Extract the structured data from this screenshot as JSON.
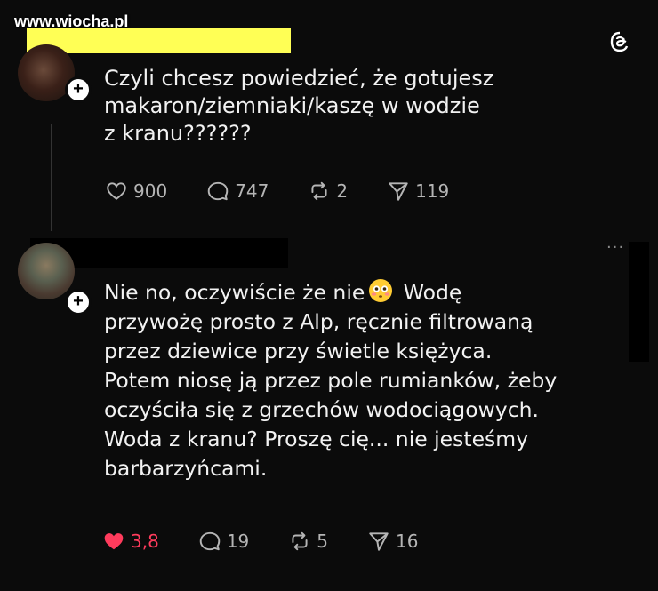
{
  "watermark": "www.wiocha.pl",
  "icons": {
    "threads": "threads-logo-icon",
    "like": "heart-icon",
    "reply": "comment-bubble-icon",
    "repost": "repost-icon",
    "share": "send-icon",
    "follow": "plus-icon",
    "more": "more-icon"
  },
  "colors": {
    "background": "#0b0b0b",
    "liked": "#ff3b5c",
    "redaction_yellow": "#ffff55"
  },
  "post1": {
    "follow_label": "+",
    "text": "Czyli chcesz powiedzieć, że gotujesz\nmakaron/ziemniaki/kaszę w wodzie\nz kranu??????",
    "stats": {
      "likes": "900",
      "replies": "747",
      "reposts": "2",
      "shares": "119"
    }
  },
  "post2": {
    "follow_label": "+",
    "text_before_emoji": "Nie no, oczywiście że nie",
    "text_after_emoji": " Wodę\nprzywożę prosto z Alp, ręcznie filtrowaną\nprzez dziewice przy świetle księżyca.\nPotem niosę ją przez pole rumianków, żeby\noczyściła się z grzechów wodociągowych.\nWoda z kranu? Proszę cię... nie jesteśmy\nbarbarzyńcami.",
    "stats": {
      "likes": "3,8",
      "replies": "19",
      "reposts": "5",
      "shares": "16"
    },
    "liked": true
  },
  "more_label": "···"
}
